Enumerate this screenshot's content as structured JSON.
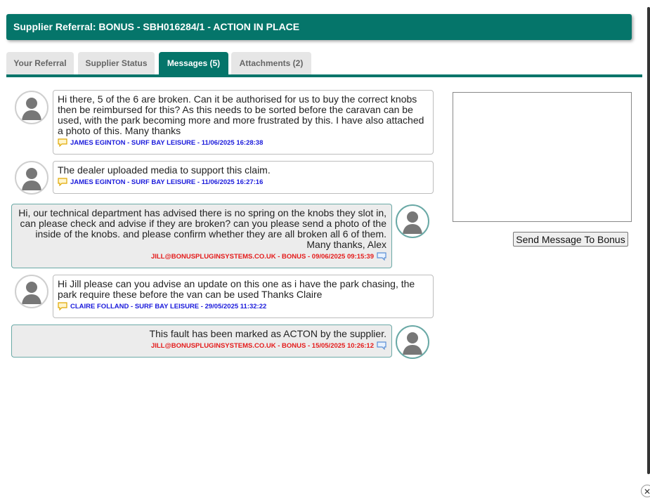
{
  "window": {
    "title": "Supplier Referral: BONUS - SBH016284/1 - ACTION IN PLACE"
  },
  "tabs": [
    {
      "label": "Your Referral",
      "active": false
    },
    {
      "label": "Supplier Status",
      "active": false
    },
    {
      "label": "Messages (5)",
      "active": true
    },
    {
      "label": "Attachments (2)",
      "active": false
    }
  ],
  "messages": [
    {
      "side": "user",
      "text": "Hi there, 5 of the 6 are broken. Can it be authorised for us to buy the correct knobs then be reimbursed for this? As this needs to be sorted before the caravan can be used, with the park becoming more and more frustrated by this. I have also attached a photo of this. Many thanks",
      "meta": "JAMES EGINTON - SURF BAY LEISURE - 11/06/2025 16:28:38"
    },
    {
      "side": "user",
      "text": "The dealer uploaded media to support this claim.",
      "meta": "JAMES EGINTON - SURF BAY LEISURE - 11/06/2025 16:27:16"
    },
    {
      "side": "supplier",
      "text": "Hi, our technical department has advised there is no spring on the knobs they slot in, can please check and advise if they are broken? can you please send a photo of the inside of the knobs. and please confirm whether they are all broken all 6 of them. Many thanks, Alex",
      "meta": "JILL@BONUSPLUGINSYSTEMS.CO.UK - BONUS - 09/06/2025 09:15:39"
    },
    {
      "side": "user",
      "text": "Hi Jill please can you advise an update on this one as i have the park chasing, the park require these before the van can be used Thanks Claire",
      "meta": "CLAIRE FOLLAND - SURF BAY LEISURE - 29/05/2025 11:32:22"
    },
    {
      "side": "supplier",
      "text": "This fault has been marked as ACTON by the supplier.",
      "meta": "JILL@BONUSPLUGINSYSTEMS.CO.UK - BONUS - 15/05/2025 10:26:12"
    }
  ],
  "compose": {
    "value": "",
    "send_label": "Send Message To Bonus"
  },
  "icons": {
    "avatar": "user-avatar-icon",
    "user_meta": "chat-bubble-orange-icon",
    "supplier_meta": "chat-bubble-blue-icon",
    "close": "close-icon"
  },
  "colors": {
    "accent": "#05756a",
    "user_meta": "#1a1adb",
    "supplier_meta": "#e41b1b"
  },
  "close_glyph": "✕"
}
